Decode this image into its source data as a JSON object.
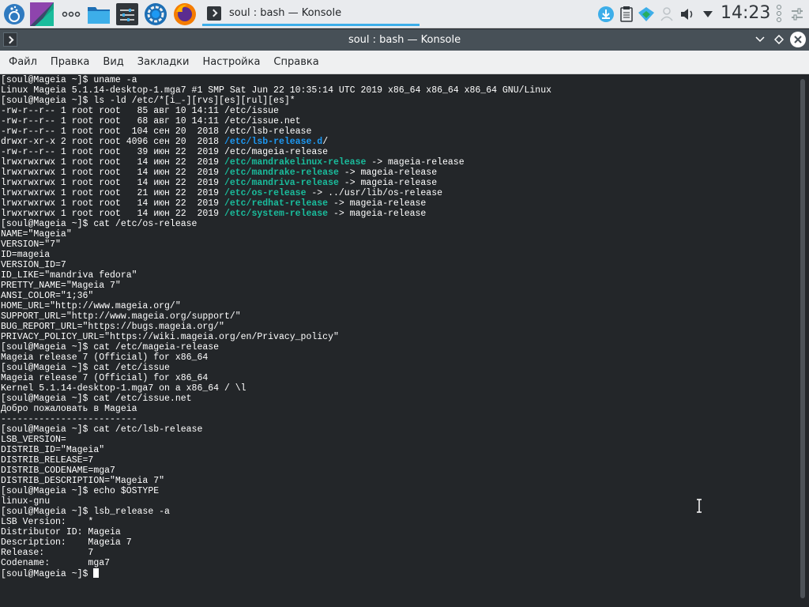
{
  "panel": {
    "task_label": "soul : bash — Konsole",
    "clock": "14:23",
    "launchers": [
      "mageia-menu-icon",
      "desktop-pager-icon",
      "more-dots-icon",
      "folder-icon",
      "settings-sliders-icon",
      "system-settings-icon",
      "firefox-icon"
    ],
    "tray_icons": [
      "download-icon",
      "clipboard-icon",
      "network-icon",
      "user-icon",
      "volume-icon",
      "tray-expand-icon"
    ]
  },
  "window": {
    "title": "soul : bash — Konsole"
  },
  "menubar": {
    "items": [
      "Файл",
      "Правка",
      "Вид",
      "Закладки",
      "Настройка",
      "Справка"
    ]
  },
  "terminal": {
    "lines": [
      [
        {
          "t": "[soul@Mageia ~]$ uname -a"
        }
      ],
      [
        {
          "t": "Linux Mageia 5.1.14-desktop-1.mga7 #1 SMP Sat Jun 22 10:35:14 UTC 2019 x86_64 x86_64 x86_64 GNU/Linux"
        }
      ],
      [
        {
          "t": "[soul@Mageia ~]$ ls -ld /etc/*[i_-][rvs][es][rul][es]*"
        }
      ],
      [
        {
          "t": "-rw-r--r-- 1 root root   85 авг 10 14:11 /etc/issue"
        }
      ],
      [
        {
          "t": "-rw-r--r-- 1 root root   68 авг 10 14:11 /etc/issue.net"
        }
      ],
      [
        {
          "t": "-rw-r--r-- 1 root root  104 сен 20  2018 /etc/lsb-release"
        }
      ],
      [
        {
          "t": "drwxr-xr-x 2 root root 4096 сен 20  2018 "
        },
        {
          "t": "/etc/lsb-release.d",
          "c": "dir"
        },
        {
          "t": "/"
        }
      ],
      [
        {
          "t": "-rw-r--r-- 1 root root   39 июн 22  2019 /etc/mageia-release"
        }
      ],
      [
        {
          "t": "lrwxrwxrwx 1 root root   14 июн 22  2019 "
        },
        {
          "t": "/etc/mandrakelinux-release",
          "c": "lnk"
        },
        {
          "t": " -> mageia-release"
        }
      ],
      [
        {
          "t": "lrwxrwxrwx 1 root root   14 июн 22  2019 "
        },
        {
          "t": "/etc/mandrake-release",
          "c": "lnk"
        },
        {
          "t": " -> mageia-release"
        }
      ],
      [
        {
          "t": "lrwxrwxrwx 1 root root   14 июн 22  2019 "
        },
        {
          "t": "/etc/mandriva-release",
          "c": "lnk"
        },
        {
          "t": " -> mageia-release"
        }
      ],
      [
        {
          "t": "lrwxrwxrwx 1 root root   21 июн 22  2019 "
        },
        {
          "t": "/etc/os-release",
          "c": "lnk"
        },
        {
          "t": " -> ../usr/lib/os-release"
        }
      ],
      [
        {
          "t": "lrwxrwxrwx 1 root root   14 июн 22  2019 "
        },
        {
          "t": "/etc/redhat-release",
          "c": "lnk"
        },
        {
          "t": " -> mageia-release"
        }
      ],
      [
        {
          "t": "lrwxrwxrwx 1 root root   14 июн 22  2019 "
        },
        {
          "t": "/etc/system-release",
          "c": "lnk"
        },
        {
          "t": " -> mageia-release"
        }
      ],
      [
        {
          "t": "[soul@Mageia ~]$ cat /etc/os-release"
        }
      ],
      [
        {
          "t": "NAME=\"Mageia\""
        }
      ],
      [
        {
          "t": "VERSION=\"7\""
        }
      ],
      [
        {
          "t": "ID=mageia"
        }
      ],
      [
        {
          "t": "VERSION_ID=7"
        }
      ],
      [
        {
          "t": "ID_LIKE=\"mandriva fedora\""
        }
      ],
      [
        {
          "t": "PRETTY_NAME=\"Mageia 7\""
        }
      ],
      [
        {
          "t": "ANSI_COLOR=\"1;36\""
        }
      ],
      [
        {
          "t": "HOME_URL=\"http://www.mageia.org/\""
        }
      ],
      [
        {
          "t": "SUPPORT_URL=\"http://www.mageia.org/support/\""
        }
      ],
      [
        {
          "t": "BUG_REPORT_URL=\"https://bugs.mageia.org/\""
        }
      ],
      [
        {
          "t": "PRIVACY_POLICY_URL=\"https://wiki.mageia.org/en/Privacy_policy\""
        }
      ],
      [
        {
          "t": "[soul@Mageia ~]$ cat /etc/mageia-release"
        }
      ],
      [
        {
          "t": "Mageia release 7 (Official) for x86_64"
        }
      ],
      [
        {
          "t": "[soul@Mageia ~]$ cat /etc/issue"
        }
      ],
      [
        {
          "t": "Mageia release 7 (Official) for x86_64"
        }
      ],
      [
        {
          "t": "Kernel 5.1.14-desktop-1.mga7 on a x86_64 / \\l"
        }
      ],
      [
        {
          "t": "[soul@Mageia ~]$ cat /etc/issue.net"
        }
      ],
      [
        {
          "t": "Добро пожаловать в Mageia"
        }
      ],
      [
        {
          "t": "-------------------------"
        }
      ],
      [
        {
          "t": "[soul@Mageia ~]$ cat /etc/lsb-release"
        }
      ],
      [
        {
          "t": "LSB_VERSION="
        }
      ],
      [
        {
          "t": "DISTRIB_ID=\"Mageia\""
        }
      ],
      [
        {
          "t": "DISTRIB_RELEASE=7"
        }
      ],
      [
        {
          "t": "DISTRIB_CODENAME=mga7"
        }
      ],
      [
        {
          "t": "DISTRIB_DESCRIPTION=\"Mageia 7\""
        }
      ],
      [
        {
          "t": "[soul@Mageia ~]$ echo $OSTYPE"
        }
      ],
      [
        {
          "t": "linux-gnu"
        }
      ],
      [
        {
          "t": "[soul@Mageia ~]$ lsb_release -a"
        }
      ],
      [
        {
          "t": "LSB Version:    *"
        }
      ],
      [
        {
          "t": "Distributor ID: Mageia"
        }
      ],
      [
        {
          "t": "Description:    Mageia 7"
        }
      ],
      [
        {
          "t": "Release:        7"
        }
      ],
      [
        {
          "t": "Codename:       mga7"
        }
      ],
      [
        {
          "t": "[soul@Mageia ~]$ "
        },
        {
          "cursor": true
        }
      ]
    ]
  },
  "colors": {
    "terminal_bg": "#232629",
    "directory": "#1d99f3",
    "symlink": "#1abc9c",
    "accent": "#3daee9"
  }
}
